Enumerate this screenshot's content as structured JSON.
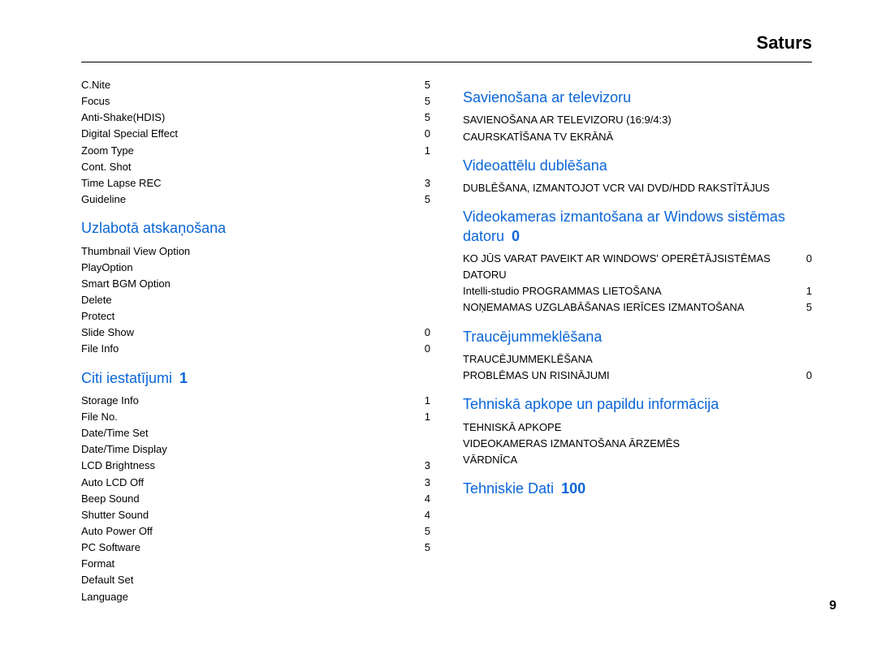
{
  "header": {
    "title": "Saturs"
  },
  "page_number": "9",
  "left": {
    "top_items": [
      {
        "label": "C.Nite",
        "page": "5"
      },
      {
        "label": "Focus",
        "page": "5"
      },
      {
        "label": "Anti-Shake(HDIS)",
        "page": "5"
      },
      {
        "label": "Digital Special Effect",
        "page": "0"
      },
      {
        "label": "Zoom Type",
        "page": "1"
      },
      {
        "label": "Cont. Shot",
        "page": ""
      },
      {
        "label": "Time Lapse REC",
        "page": "3"
      },
      {
        "label": "Guideline",
        "page": "5"
      }
    ],
    "sec1": {
      "title": "Uzlabotā atskaņošana",
      "title_page": "",
      "items": [
        {
          "label": "Thumbnail View Option",
          "page": ""
        },
        {
          "label": "PlayOption",
          "page": ""
        },
        {
          "label": "Smart BGM Option",
          "page": ""
        },
        {
          "label": "Delete",
          "page": ""
        },
        {
          "label": "Protect",
          "page": ""
        },
        {
          "label": "Slide Show",
          "page": "0"
        },
        {
          "label": "File Info",
          "page": "0"
        }
      ]
    },
    "sec2": {
      "title": "Citi iestatījumi",
      "title_page": "1",
      "items": [
        {
          "label": "Storage Info",
          "page": "1"
        },
        {
          "label": "File No.",
          "page": "1"
        },
        {
          "label": "Date/Time Set",
          "page": ""
        },
        {
          "label": "Date/Time Display",
          "page": ""
        },
        {
          "label": "LCD Brightness",
          "page": "3"
        },
        {
          "label": "Auto LCD Off",
          "page": "3"
        },
        {
          "label": "Beep Sound",
          "page": "4"
        },
        {
          "label": "Shutter Sound",
          "page": "4"
        },
        {
          "label": "Auto Power Off",
          "page": "5"
        },
        {
          "label": "PC Software",
          "page": "5"
        },
        {
          "label": "Format",
          "page": ""
        },
        {
          "label": "Default Set",
          "page": ""
        },
        {
          "label": "Language",
          "page": ""
        }
      ]
    }
  },
  "right": {
    "sec1": {
      "title": "Savienošana ar televizoru",
      "title_page": "",
      "items": [
        {
          "label": "SAVIENOŠANA AR TELEVIZORU (16:9/4:3)",
          "page": ""
        },
        {
          "label": "CAURSKATĪŠANA TV EKRĀNĀ",
          "page": ""
        }
      ]
    },
    "sec2": {
      "title": "Videoattēlu dublēšana",
      "title_page": "",
      "items": [
        {
          "label": "DUBLĒŠANA, IZMANTOJOT VCR VAI DVD/HDD RAKSTĪTĀJUS",
          "page": ""
        }
      ]
    },
    "sec3": {
      "title": "Videokameras izmantošana ar Windows sistēmas datoru",
      "title_page": "0",
      "items": [
        {
          "label": "KO JŪS VARAT PAVEIKT AR WINDOWS' OPERĒTĀJSISTĒMAS DATORU",
          "page": "0"
        },
        {
          "label": "Intelli-studio PROGRAMMAS LIETOŠANA",
          "page": "1"
        },
        {
          "label": "NOŅEMAMAS UZGLABĀŠANAS IERĪCES IZMANTOŠANA",
          "page": "5"
        }
      ]
    },
    "sec4": {
      "title": "Traucējummeklēšana",
      "title_page": "",
      "items": [
        {
          "label": "TRAUCĒJUMMEKLĒŠANA",
          "page": ""
        },
        {
          "label": "PROBLĒMAS UN RISINĀJUMI",
          "page": "0"
        }
      ]
    },
    "sec5": {
      "title": "Tehniskā apkope un papildu informācija",
      "title_page": "",
      "items": [
        {
          "label": "TEHNISKĀ APKOPE",
          "page": ""
        },
        {
          "label": "VIDEOKAMERAS IZMANTOŠANA ĀRZEMĒS",
          "page": ""
        },
        {
          "label": "VĀRDNĪCA",
          "page": ""
        }
      ]
    },
    "sec6": {
      "title": "Tehniskie Dati",
      "title_page": "100",
      "items": []
    }
  }
}
